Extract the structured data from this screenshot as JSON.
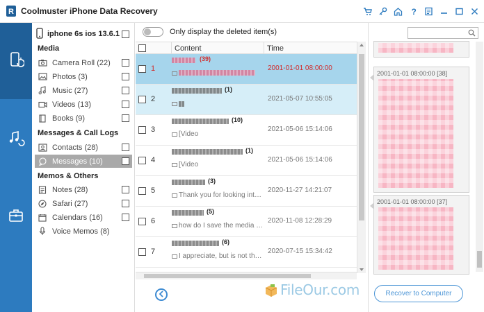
{
  "app": {
    "title": "Coolmuster iPhone Data Recovery"
  },
  "titlebar_icons": [
    "cart-icon",
    "key-icon",
    "home-icon",
    "help-icon",
    "feedback-icon",
    "minimize-icon",
    "maximize-icon",
    "close-icon"
  ],
  "device": {
    "name": "iphone 6s ios 13.6.1"
  },
  "sections": {
    "media": "Media",
    "messages": "Messages & Call Logs",
    "memos": "Memos & Others"
  },
  "categories": [
    {
      "label": "Camera Roll",
      "count": "(22)"
    },
    {
      "label": "Photos",
      "count": "(3)"
    },
    {
      "label": "Music",
      "count": "(27)"
    },
    {
      "label": "Videos",
      "count": "(13)"
    },
    {
      "label": "Books",
      "count": "(9)"
    },
    {
      "label": "Contacts",
      "count": "(28)"
    },
    {
      "label": "Messages",
      "count": "(10)"
    },
    {
      "label": "Notes",
      "count": "(28)"
    },
    {
      "label": "Safari",
      "count": "(27)"
    },
    {
      "label": "Calendars",
      "count": "(16)"
    },
    {
      "label": "Voice Memos",
      "count": "(8)"
    }
  ],
  "toggle_label": "Only display the deleted item(s)",
  "list_headers": {
    "content": "Content",
    "time": "Time"
  },
  "rows": [
    {
      "num": "1",
      "count": "(39)",
      "preview": "",
      "time": "2001-01-01 08:00:00"
    },
    {
      "num": "2",
      "count": "(1)",
      "preview": "",
      "time": "2021-05-07 10:55:05"
    },
    {
      "num": "3",
      "count": "(10)",
      "preview": "[Video",
      "time": "2021-05-06 15:14:06"
    },
    {
      "num": "4",
      "count": "(1)",
      "preview": "[Video",
      "time": "2021-05-06 15:14:06"
    },
    {
      "num": "5",
      "count": "(3)",
      "preview": "Thank you for looking into t...",
      "time": "2020-11-27 14:21:07"
    },
    {
      "num": "6",
      "count": "(5)",
      "preview": "how do I save the media in...",
      "time": "2020-11-08 12:28:29"
    },
    {
      "num": "7",
      "count": "(6)",
      "preview": "I appreciate, but is not the ...",
      "time": "2020-07-15 15:34:42"
    }
  ],
  "preview_bubbles": [
    {
      "time": ""
    },
    {
      "time": "2001-01-01 08:00:00 [38]"
    },
    {
      "time": "2001-01-01 08:00:00 [37]"
    }
  ],
  "recover_label": "Recover to Computer",
  "watermark": "FileOur.com",
  "colors": {
    "nav_bg": "#2d7bbf",
    "nav_active": "#1f5f98",
    "row_selected": "#a6d5ec",
    "deleted_text": "#d12b2b",
    "accent": "#4c95d6"
  }
}
